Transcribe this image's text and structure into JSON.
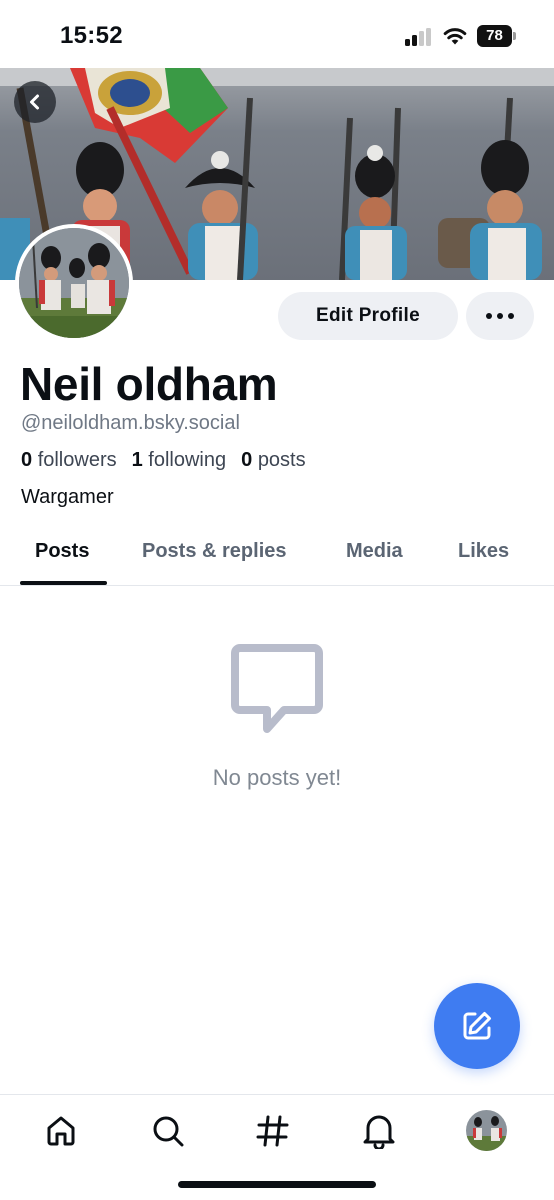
{
  "status_bar": {
    "time": "15:52",
    "battery": "78"
  },
  "profile": {
    "display_name": "Neil oldham",
    "handle": "@neiloldham.bsky.social",
    "bio": "Wargamer",
    "stats": {
      "followers_count": "0",
      "followers_label": "followers",
      "following_count": "1",
      "following_label": "following",
      "posts_count": "0",
      "posts_label": "posts"
    }
  },
  "actions": {
    "edit_profile_label": "Edit Profile"
  },
  "tabs": [
    {
      "label": "Posts",
      "active": true
    },
    {
      "label": "Posts & replies",
      "active": false
    },
    {
      "label": "Media",
      "active": false
    },
    {
      "label": "Likes",
      "active": false
    }
  ],
  "empty_state": {
    "message": "No posts yet!"
  },
  "bottom_nav": [
    "home-icon",
    "search-icon",
    "hashtag-icon",
    "notifications-bell-icon",
    "profile-avatar"
  ],
  "colors": {
    "accent": "#3f7cf1",
    "muted_text": "#6f7885",
    "button_bg": "#eef0f4"
  }
}
